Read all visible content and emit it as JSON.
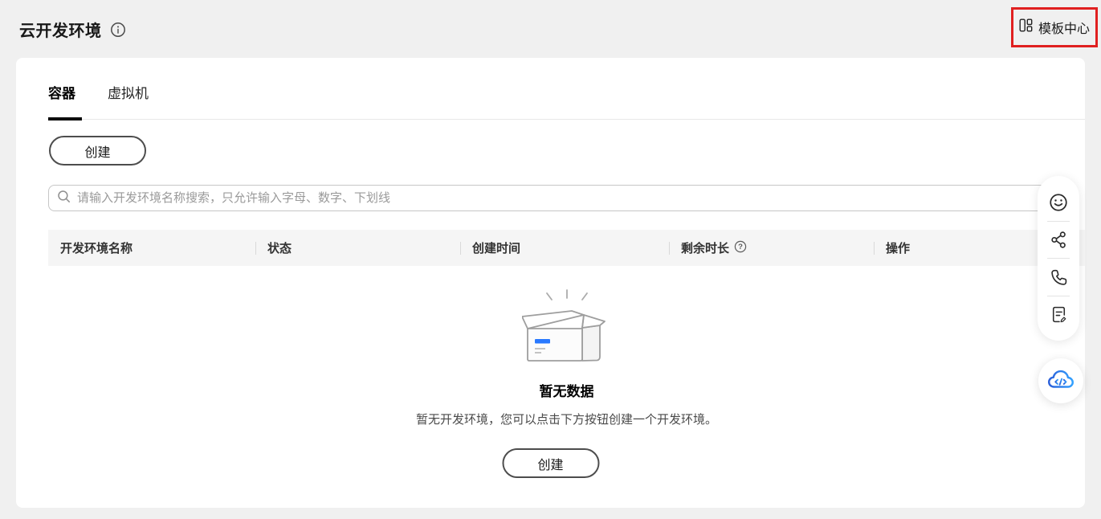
{
  "header": {
    "title": "云开发环境",
    "template_center_label": "模板中心"
  },
  "tabs": [
    {
      "label": "容器",
      "active": true
    },
    {
      "label": "虚拟机",
      "active": false
    }
  ],
  "actions": {
    "create_label": "创建"
  },
  "search": {
    "placeholder": "请输入开发环境名称搜索，只允许输入字母、数字、下划线",
    "value": ""
  },
  "table": {
    "columns": [
      "开发环境名称",
      "状态",
      "创建时间",
      "剩余时长",
      "操作"
    ]
  },
  "empty_state": {
    "title": "暂无数据",
    "description": "暂无开发环境，您可以点击下方按钮创建一个开发环境。",
    "create_label": "创建"
  },
  "side_toolbar": {
    "icons": [
      "smiley-icon",
      "share-icon",
      "phone-icon",
      "feedback-icon"
    ],
    "fab_icon": "cloud-code-icon"
  },
  "colors": {
    "annotation_red": "#e02020",
    "accent_blue": "#2979ff",
    "cloud_gradient_start": "#2b5fd9",
    "cloud_gradient_end": "#33a1ff",
    "page_background": "#f0f0f0",
    "table_header_background": "#f5f5f5"
  }
}
